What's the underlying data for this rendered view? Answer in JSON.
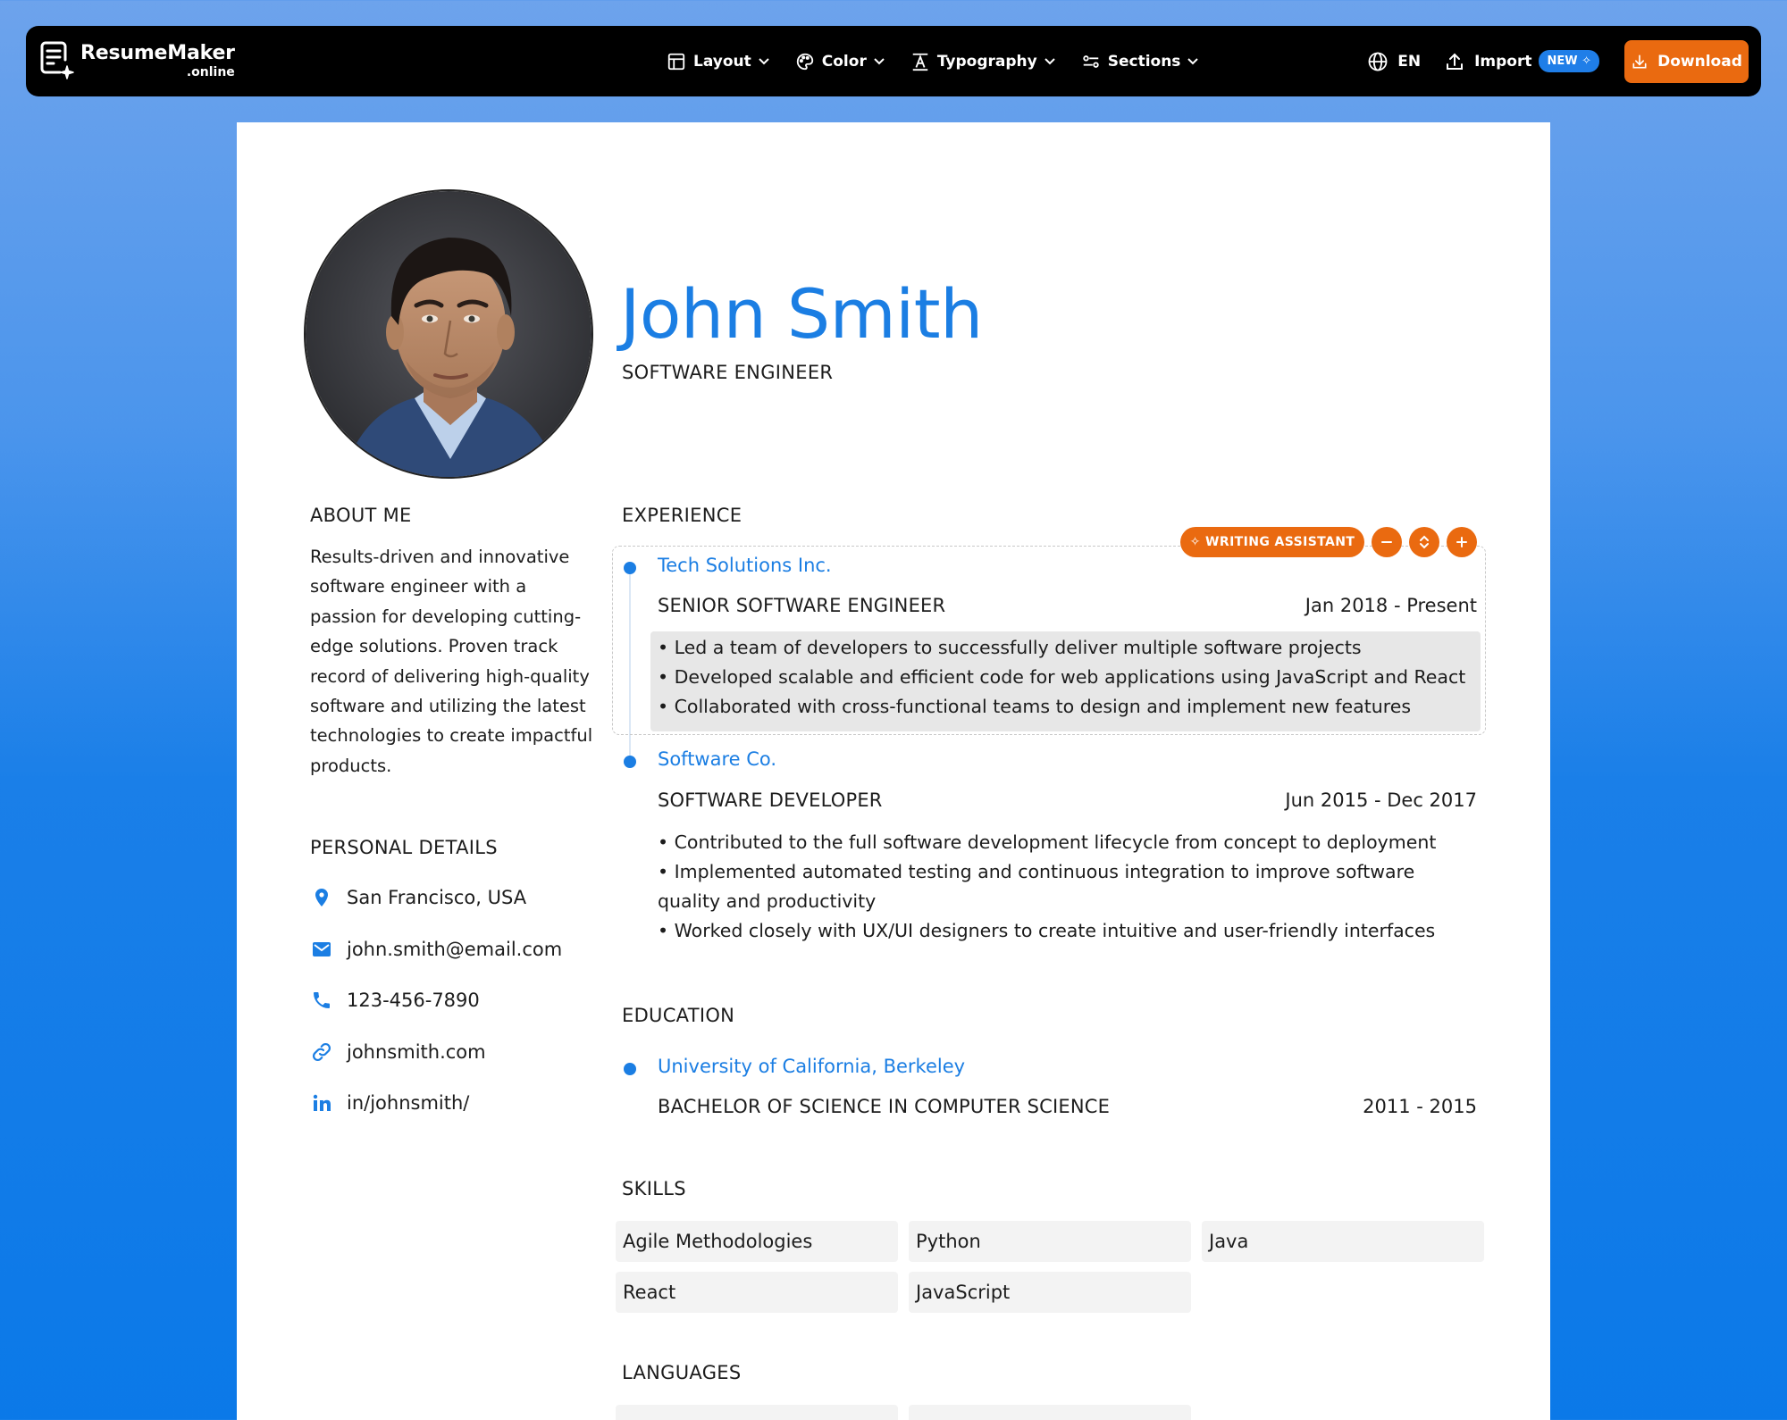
{
  "app": {
    "logo_main": "ResumeMaker",
    "logo_sub": ".online"
  },
  "toolbar": {
    "menu": [
      {
        "label": "Layout",
        "icon": "layout-icon"
      },
      {
        "label": "Color",
        "icon": "palette-icon"
      },
      {
        "label": "Typography",
        "icon": "typography-icon"
      },
      {
        "label": "Sections",
        "icon": "sections-icon"
      }
    ],
    "language": "EN",
    "import_label": "Import",
    "new_badge": "NEW ✧",
    "download_label": "Download"
  },
  "colors": {
    "accent": "#1b7ee3",
    "action": "#ea6a10",
    "toolbar_bg": "#000000"
  },
  "resume": {
    "name": "John Smith",
    "title": "SOFTWARE ENGINEER",
    "about": {
      "heading": "ABOUT ME",
      "text": "Results-driven and innovative software engineer with a passion for developing cutting-edge solutions. Proven track record of delivering high-quality software and utilizing the latest technologies to create impactful products."
    },
    "personal_details": {
      "heading": "PERSONAL DETAILS",
      "items": [
        {
          "icon": "location-pin-icon",
          "value": "San Francisco, USA"
        },
        {
          "icon": "email-icon",
          "value": "john.smith@email.com"
        },
        {
          "icon": "phone-icon",
          "value": "123-456-7890"
        },
        {
          "icon": "link-icon",
          "value": "johnsmith.com"
        },
        {
          "icon": "linkedin-icon",
          "value": "in/johnsmith/"
        }
      ]
    },
    "experience": {
      "heading": "EXPERIENCE",
      "writing_assistant_label": "✧ WRITING ASSISTANT",
      "items": [
        {
          "company": "Tech Solutions Inc.",
          "role": "SENIOR SOFTWARE ENGINEER",
          "dates": "Jan 2018 - Present",
          "bullets": [
            "Led a team of developers to successfully deliver multiple software projects",
            "Developed scalable and efficient code for web applications using JavaScript and React",
            "Collaborated with cross-functional teams to design and implement new features"
          ]
        },
        {
          "company": "Software Co.",
          "role": "SOFTWARE DEVELOPER",
          "dates": "Jun 2015 - Dec 2017",
          "bullets": [
            "Contributed to the full software development lifecycle from concept to deployment",
            "Implemented automated testing and continuous integration to improve software quality and productivity",
            "Worked closely with UX/UI designers to create intuitive and user-friendly interfaces"
          ]
        }
      ]
    },
    "education": {
      "heading": "EDUCATION",
      "items": [
        {
          "school": "University of California, Berkeley",
          "degree": "BACHELOR OF SCIENCE IN COMPUTER SCIENCE",
          "dates": "2011 - 2015"
        }
      ]
    },
    "skills": {
      "heading": "SKILLS",
      "items": [
        "Agile Methodologies",
        "Python",
        "Java",
        "React",
        "JavaScript"
      ]
    },
    "languages": {
      "heading": "LANGUAGES"
    }
  }
}
